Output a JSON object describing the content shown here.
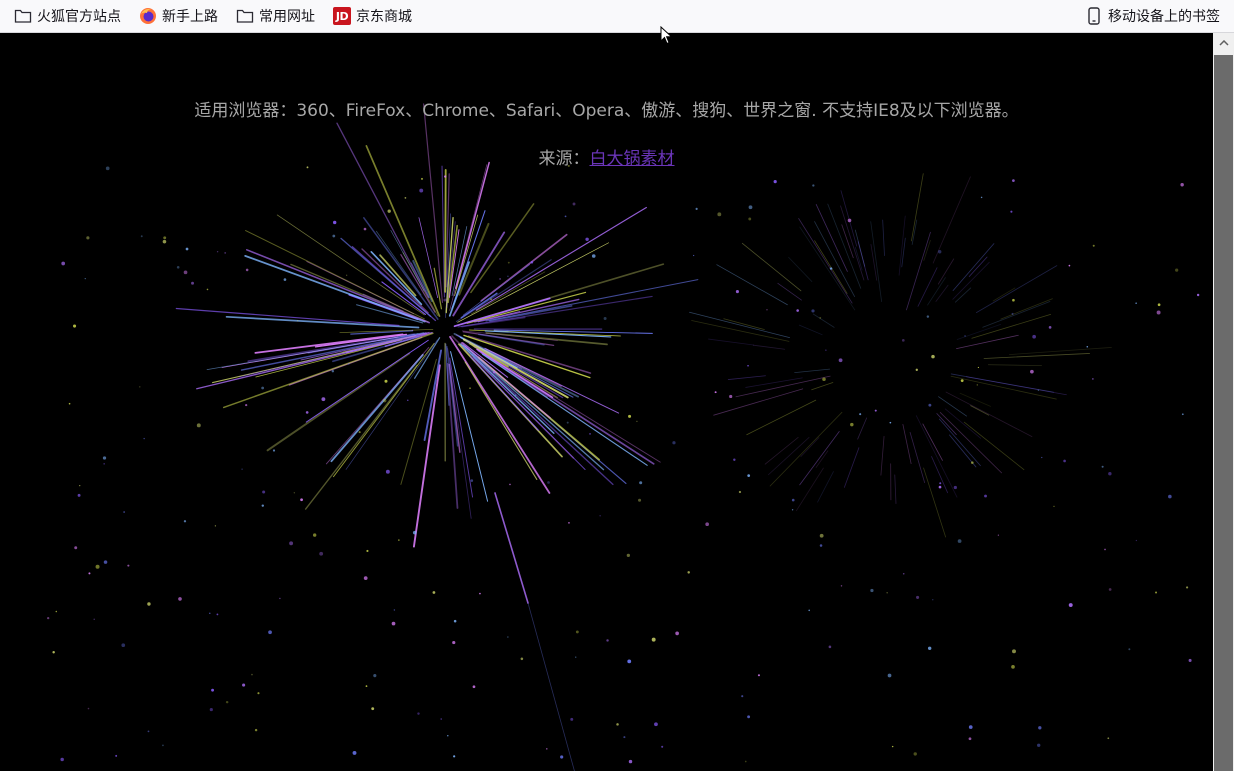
{
  "bookmarks": {
    "items": [
      {
        "label": "火狐官方站点",
        "icon": "folder-icon"
      },
      {
        "label": "新手上路",
        "icon": "firefox-icon"
      },
      {
        "label": "常用网址",
        "icon": "folder-icon"
      },
      {
        "label": "京东商城",
        "icon": "jd-icon"
      }
    ],
    "jd_icon_text": "JD",
    "mobile": {
      "label": "移动设备上的书签",
      "icon": "mobile-device-icon"
    }
  },
  "page": {
    "info_text": "适用浏览器：360、FireFox、Chrome、Safari、Opera、傲游、搜狗、世界之窗. 不支持IE8及以下浏览器。",
    "source_prefix": "来源：",
    "source_link": "白大锅素材"
  },
  "colors": {
    "background": "#000000",
    "text": "#a7a7a7",
    "link": "#6a35b8",
    "firework_primary": "#8a5cff",
    "firework_secondary": "#c8d24a"
  }
}
